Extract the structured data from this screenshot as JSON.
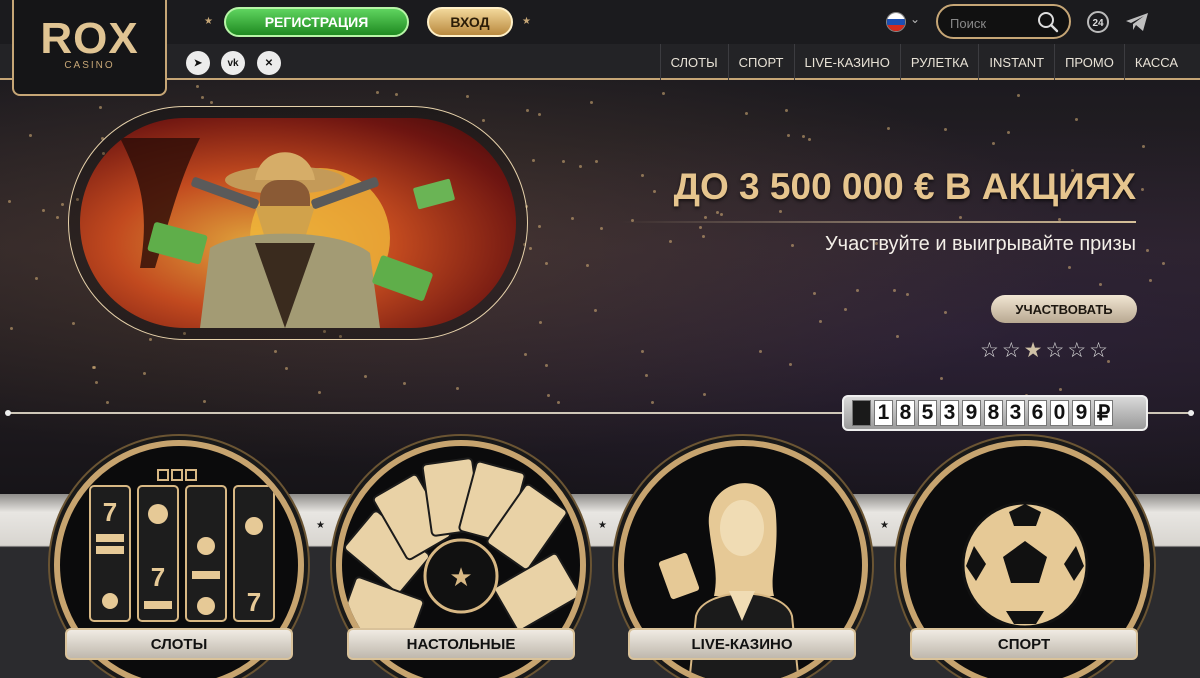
{
  "header": {
    "logo_main": "ROX",
    "logo_sub": "CASINO",
    "register_label": "РЕГИСТРАЦИЯ",
    "login_label": "ВХОД",
    "search_placeholder": "Поиск",
    "support_badge": "24",
    "language_flag": "russia-flag"
  },
  "social": [
    {
      "icon": "telegram-icon",
      "glyph": "➤"
    },
    {
      "icon": "vk-icon",
      "glyph": "vk"
    },
    {
      "icon": "x-icon",
      "glyph": "✕"
    }
  ],
  "nav": {
    "items": [
      "СЛОТЫ",
      "СПОРТ",
      "LIVE-КАЗИНО",
      "РУЛЕТКА",
      "INSTANT",
      "ПРОМО",
      "КАССА"
    ]
  },
  "promo": {
    "title": "ДО 3 500 000 € В АКЦИЯХ",
    "subtitle": "Участвуйте и выигрывайте призы",
    "button_label": "УЧАСТВОВАТЬ",
    "slides_total": 6,
    "slide_active": 3
  },
  "jackpot": {
    "digits": [
      "",
      "1",
      "8",
      "5",
      "3",
      "9",
      "8",
      "3",
      "6",
      "0",
      "9",
      "₽"
    ]
  },
  "categories": [
    "СЛОТЫ",
    "НАСТОЛЬНЫЕ",
    "LIVE-КАЗИНО",
    "СПОРТ"
  ],
  "colors": {
    "accent_gold": "#c6a676",
    "register_green": "#2fa52f",
    "login_gold": "#d8b46a"
  }
}
